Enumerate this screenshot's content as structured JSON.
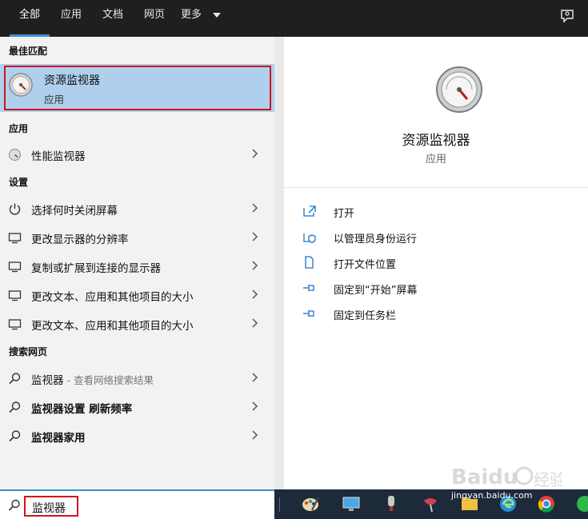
{
  "tabs": [
    "全部",
    "应用",
    "文档",
    "网页",
    "更多"
  ],
  "sections": {
    "best_match": "最佳匹配",
    "apps": "应用",
    "settings": "设置",
    "web": "搜索网页"
  },
  "best_match": {
    "title": "资源监视器",
    "subtitle": "应用",
    "icon": "resource-monitor-icon"
  },
  "apps": [
    {
      "label": "性能监视器",
      "icon": "performance-monitor-icon"
    }
  ],
  "settings": [
    {
      "label": "选择何时关闭屏幕",
      "icon": "power-icon"
    },
    {
      "label": "更改显示器的分辨率",
      "icon": "monitor-icon"
    },
    {
      "label": "复制或扩展到连接的显示器",
      "icon": "monitor-icon"
    },
    {
      "label": "更改文本、应用和其他项目的大小",
      "icon": "monitor-icon"
    },
    {
      "label": "更改文本、应用和其他项目的大小",
      "icon": "monitor-icon"
    }
  ],
  "web": [
    {
      "label": "监视器",
      "hint": " - 查看网络搜索结果",
      "icon": "search-icon"
    },
    {
      "label": "监视器设置 刷新频率",
      "icon": "search-icon"
    },
    {
      "label": "监视器家用",
      "icon": "search-icon"
    }
  ],
  "detail": {
    "name": "资源监视器",
    "type": "应用",
    "actions": [
      {
        "label": "打开",
        "icon": "open-icon"
      },
      {
        "label": "以管理员身份运行",
        "icon": "admin-shield-icon"
      },
      {
        "label": "打开文件位置",
        "icon": "file-location-icon"
      },
      {
        "label": "固定到“开始”屏幕",
        "icon": "pin-icon"
      },
      {
        "label": "固定到任务栏",
        "icon": "pin-icon"
      }
    ]
  },
  "search": {
    "value": "监视器"
  },
  "watermark": {
    "text": "jingyan.baidu.com"
  },
  "colors": {
    "accent": "#3a8fd9",
    "highlight": "#afd0ec",
    "annotation_red": "#d1141b",
    "topbar": "#1f1f1f"
  }
}
